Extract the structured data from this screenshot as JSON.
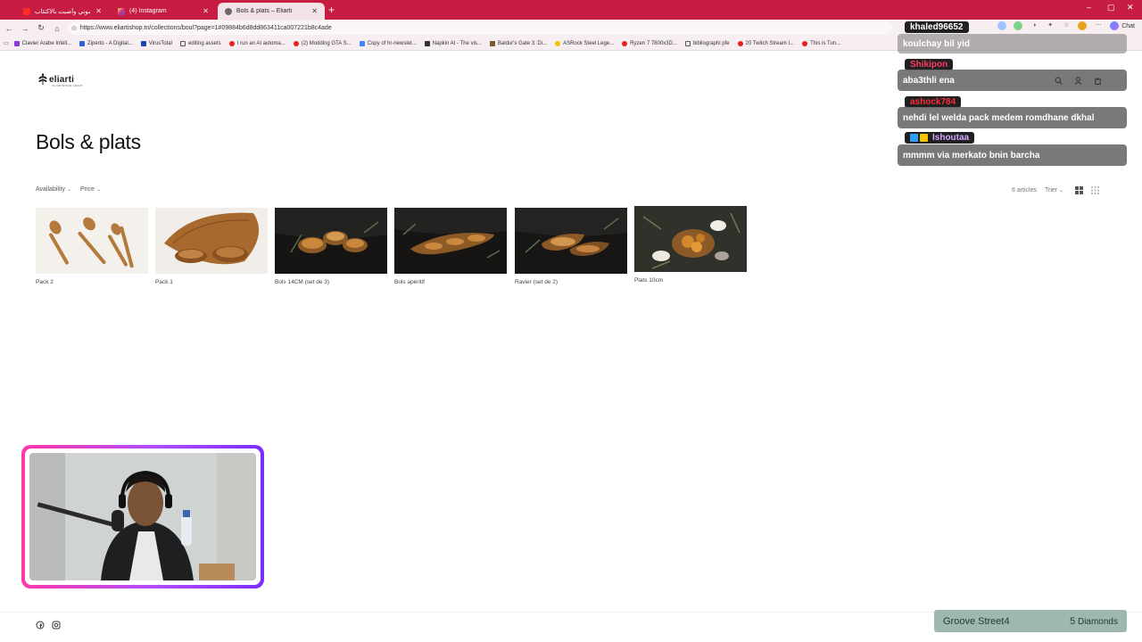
{
  "browser": {
    "tabs": [
      {
        "title": "لدى عبيد تعلموني وأصبت بالاكتئاب",
        "active": false
      },
      {
        "title": "(4) Instagram",
        "active": false
      },
      {
        "title": "Bols & plats – Eliarti",
        "active": true
      }
    ],
    "new_tab": "+",
    "url": "https://www.eliartishop.tn/collections/boul?page=1#09884b6d8dd863411ca007221b8c4ade",
    "chat_button": "Chat",
    "window_controls": [
      "–",
      "▢",
      "✕"
    ],
    "bookmarks": [
      "Clavier Arabe Intell...",
      "Ziperto - A Digital...",
      "VirusTotal",
      "editing assets",
      "I run an AI automa...",
      "(2) Modding GTA S...",
      "Copy of hr-newslet...",
      "Napkin AI - The vis...",
      "Baldur's Gate 3: Di...",
      "ASRock Steel Lege...",
      "Ryzen 7 7800x3D...",
      "bibliographi pfe",
      "20 Twitch Stream I...",
      "This is Tun..."
    ]
  },
  "store": {
    "logo": "eliarti",
    "logo_sub": "OLIVE WOOD CRAFT",
    "title": "Bols & plats",
    "filters": [
      "Availability",
      "Price"
    ],
    "count": "6 articles",
    "sort": "Trier",
    "products": [
      {
        "name": "Pack 2"
      },
      {
        "name": "Pack 1"
      },
      {
        "name": "Bols 14CM (set de 3)"
      },
      {
        "name": "Bols apéritif"
      },
      {
        "name": "Ravier (set de 2)"
      },
      {
        "name": "Plats 10cm"
      }
    ]
  },
  "stream": {
    "chat": [
      {
        "user": "khaled96652",
        "user_color": "#ffffff",
        "message": "koulchay bil yid"
      },
      {
        "user": "Shikipon",
        "user_color": "#ff3b5c",
        "message": "aba3thli ena"
      },
      {
        "user": "ashock784",
        "user_color": "#ff2a3a",
        "message": "nehdi lel welda pack medem romdhane dkhal"
      },
      {
        "user": "Ishoutaa",
        "user_color": "#d9a8ff",
        "message": "mmmm via merkato bnin barcha"
      }
    ],
    "goal": {
      "name": "Groove Street4",
      "value": "5",
      "unit": "Diamonds"
    }
  },
  "colors": {
    "tab_bar": "#c71d42",
    "cam_gradient_start": "#ff3aa6",
    "cam_gradient_end": "#7a2dff",
    "goal_bg": "#9fb8ae"
  }
}
